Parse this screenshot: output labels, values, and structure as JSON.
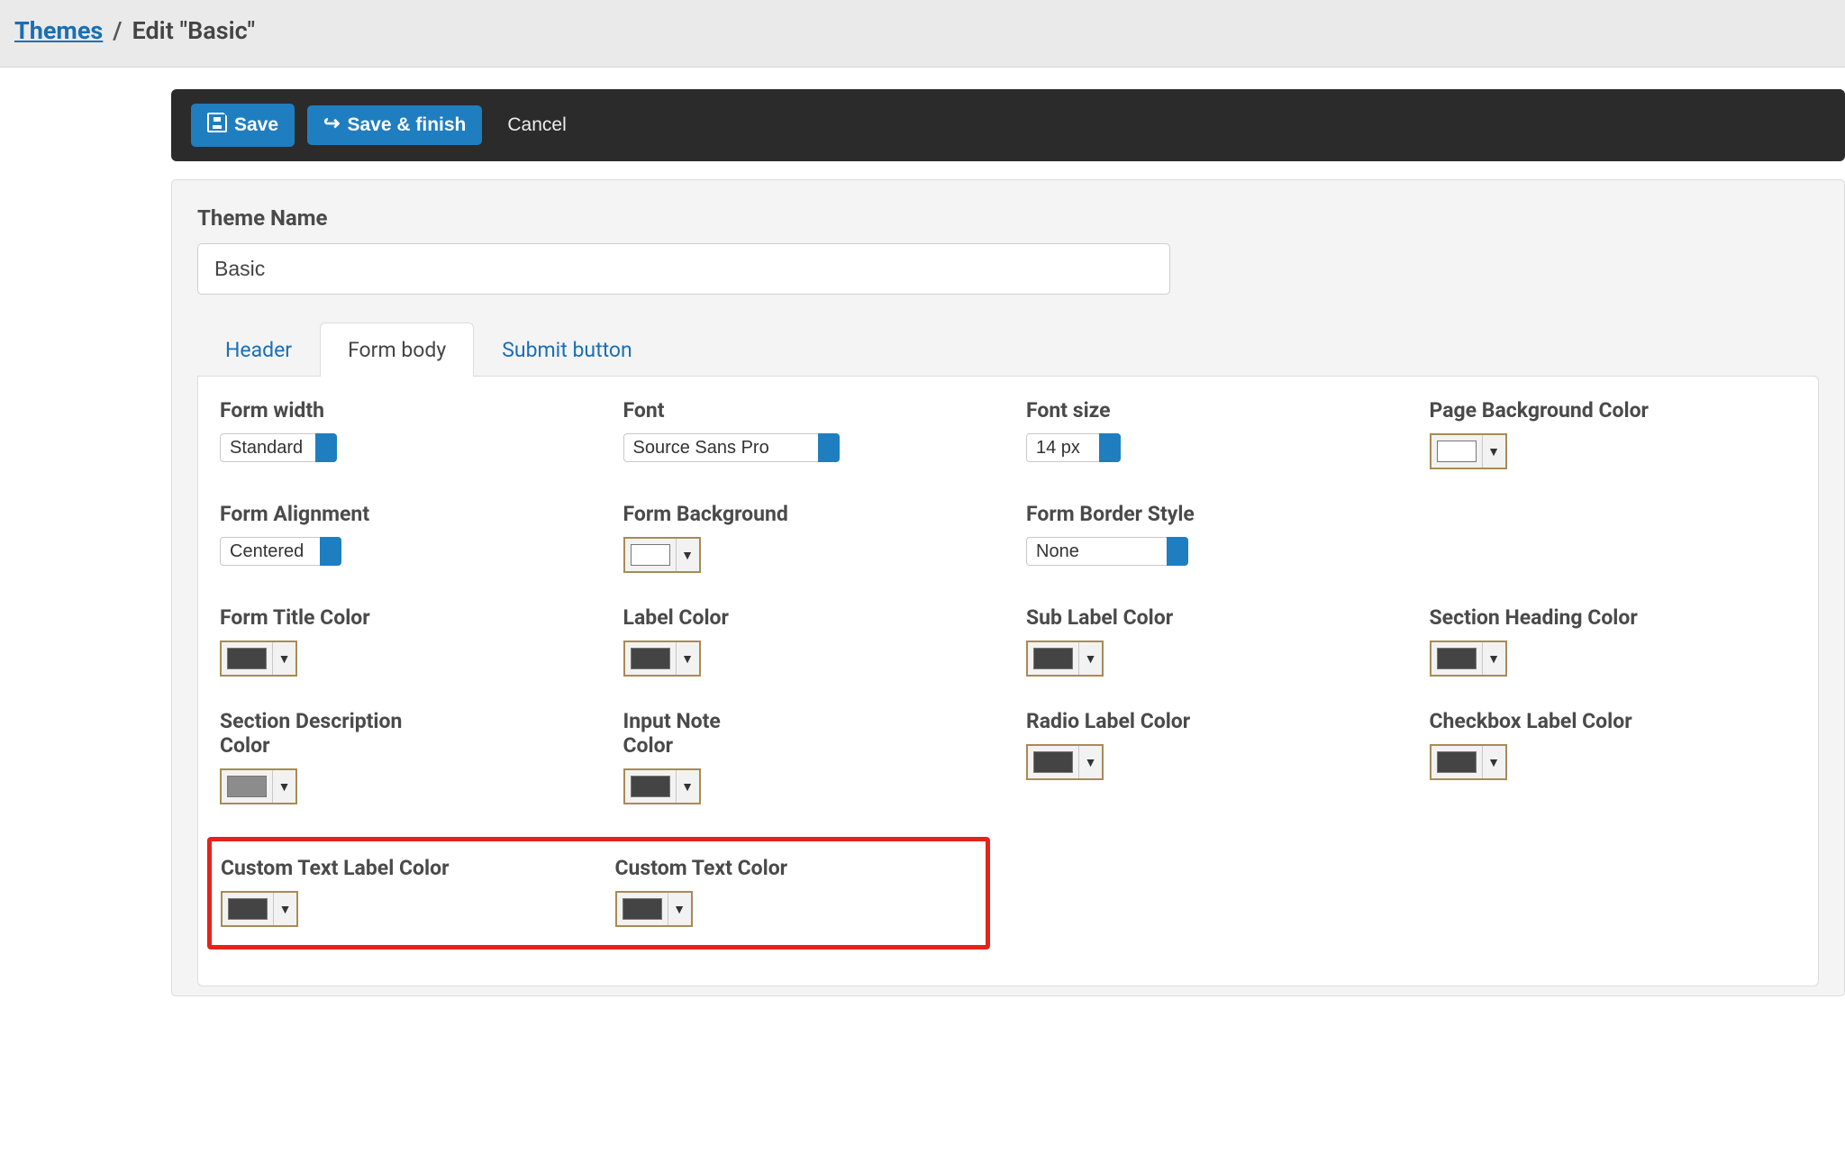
{
  "breadcrumb": {
    "root_label": "Themes",
    "separator": "/",
    "current": "Edit \"Basic\""
  },
  "toolbar": {
    "save_label": "Save",
    "save_finish_label": "Save & finish",
    "cancel_label": "Cancel"
  },
  "theme_name": {
    "label": "Theme Name",
    "value": "Basic"
  },
  "tabs": {
    "header": "Header",
    "form_body": "Form body",
    "submit_button": "Submit button"
  },
  "form_body": {
    "form_width": {
      "label": "Form width",
      "value": "Standard"
    },
    "font": {
      "label": "Font",
      "value": "Source Sans Pro"
    },
    "font_size": {
      "label": "Font size",
      "value": "14 px"
    },
    "page_bg": {
      "label": "Page Background Color",
      "value": "#ffffff"
    },
    "form_alignment": {
      "label": "Form Alignment",
      "value": "Centered"
    },
    "form_background": {
      "label": "Form Background",
      "value": "#ffffff"
    },
    "form_border_style": {
      "label": "Form Border Style",
      "value": "None"
    },
    "form_title_color": {
      "label": "Form Title Color",
      "value": "#444444"
    },
    "label_color": {
      "label": "Label Color",
      "value": "#444444"
    },
    "sub_label_color": {
      "label": "Sub Label Color",
      "value": "#444444"
    },
    "section_heading_color": {
      "label": "Section Heading Color",
      "value": "#444444"
    },
    "section_description_color": {
      "label": "Section Description Color",
      "value": "#8c8c8c"
    },
    "input_note_color": {
      "label": "Input Note Color",
      "value": "#444444"
    },
    "radio_label_color": {
      "label": "Radio Label Color",
      "value": "#444444"
    },
    "checkbox_label_color": {
      "label": "Checkbox Label Color",
      "value": "#444444"
    },
    "custom_text_label_color": {
      "label": "Custom Text Label Color",
      "value": "#444444"
    },
    "custom_text_color": {
      "label": "Custom Text Color",
      "value": "#444444"
    }
  },
  "colors": {
    "accent": "#1f7ec0",
    "toolbar_bg": "#2b2b2b",
    "highlight": "#e5231a"
  }
}
